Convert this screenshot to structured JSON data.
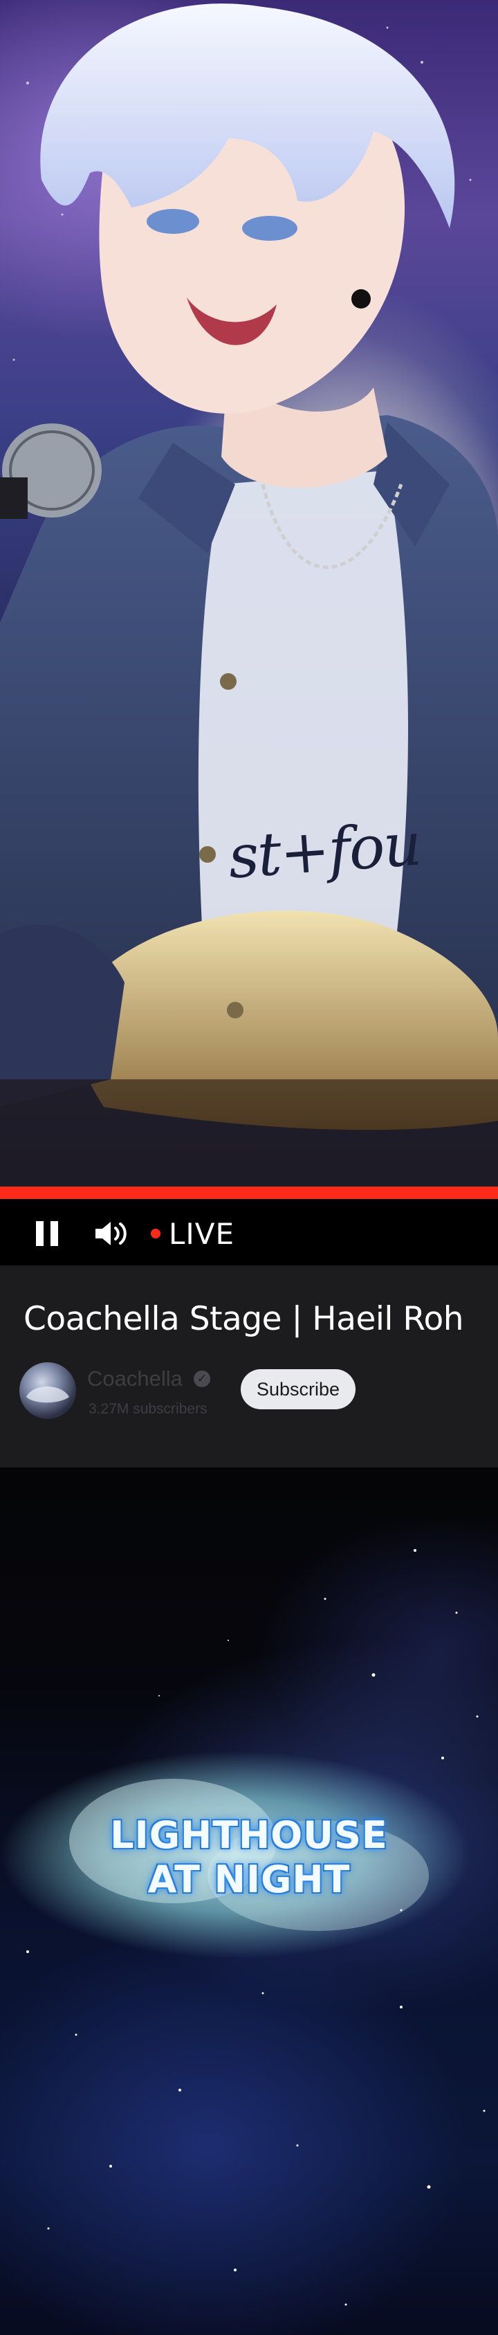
{
  "player": {
    "live_label": "LIVE",
    "progress_fraction": 1.0,
    "accent_color": "#ff2a1a",
    "icons": {
      "pause": "pause-icon",
      "volume": "volume-icon",
      "live": "live-dot-icon"
    }
  },
  "video": {
    "title": "Coachella Stage | Haeil Roh",
    "channel_name": "Coachella",
    "subscribers": "3.27M subscribers",
    "subscribe_label": "Subscribe",
    "verified_icon": "verified-check-icon"
  },
  "artwork": {
    "shirt_text": "st+fou"
  },
  "caption": {
    "line1": "LIGHTHOUSE",
    "line2": "AT NIGHT"
  }
}
